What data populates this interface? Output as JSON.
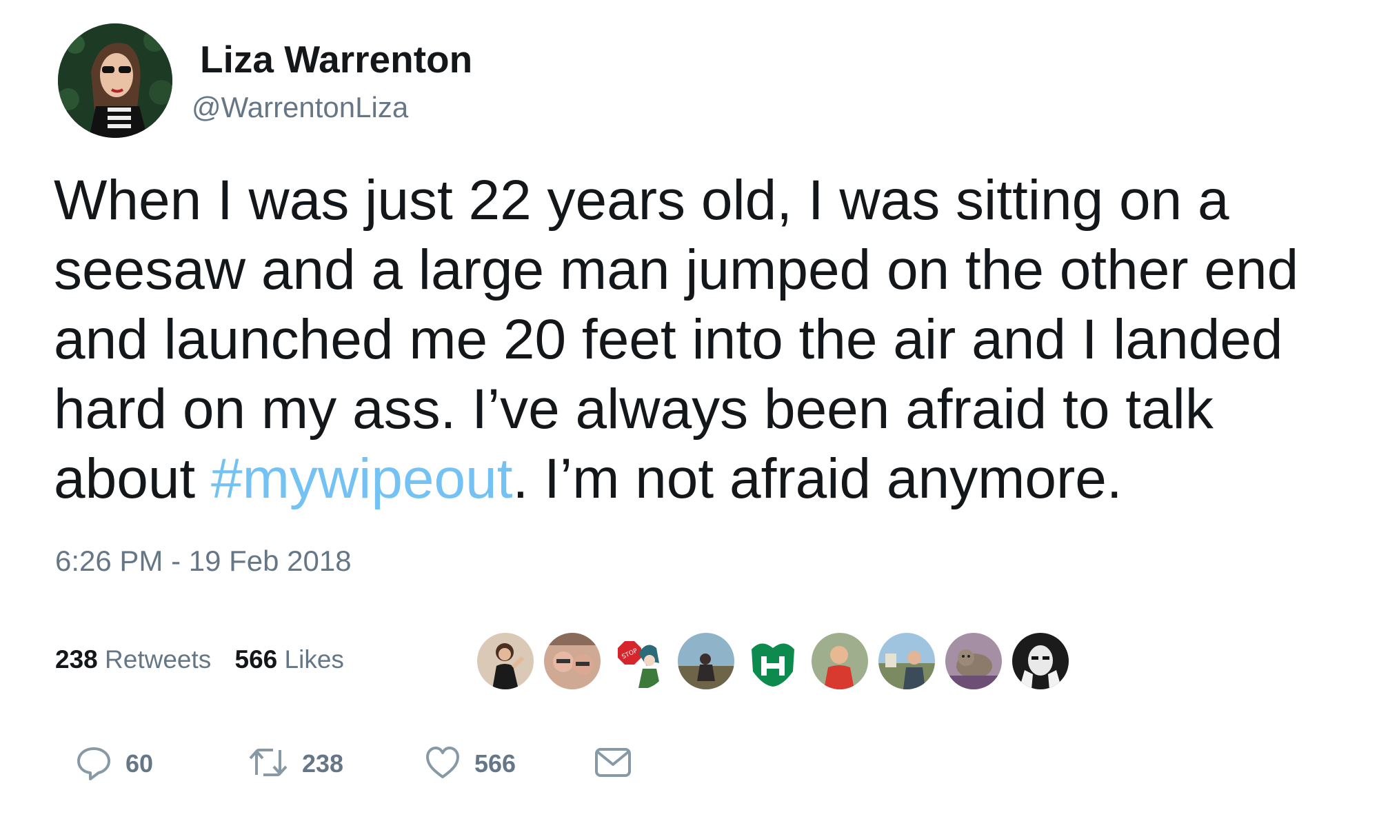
{
  "tweet": {
    "author": {
      "display_name": "Liza Warrenton",
      "handle": "@WarrentonLiza"
    },
    "text_lines": [
      {
        "before": "When I was just 22 years old, I was sitting on a",
        "hashtag": "",
        "after": ""
      },
      {
        "before": "seesaw and a large man jumped on the other end",
        "hashtag": "",
        "after": ""
      },
      {
        "before": "and launched me 20 feet into the air and I landed",
        "hashtag": "",
        "after": ""
      },
      {
        "before": "hard on my ass. I’ve always been afraid to talk",
        "hashtag": "",
        "after": ""
      },
      {
        "before": "about ",
        "hashtag": "#mywipeout",
        "after": ". I’m not afraid anymore."
      }
    ],
    "timestamp": "6:26 PM - 19 Feb 2018",
    "stats": {
      "retweets_count": "238",
      "retweets_label": "Retweets",
      "likes_count": "566",
      "likes_label": "Likes"
    },
    "actions": {
      "reply_count": "60",
      "retweet_count": "238",
      "like_count": "566"
    },
    "icons": [
      "reply-icon",
      "retweet-icon",
      "like-icon",
      "direct-message-icon"
    ],
    "colors": {
      "text": "#14171a",
      "secondary": "#657786",
      "hashtag": "#74c2f4",
      "background": "#ffffff"
    }
  }
}
